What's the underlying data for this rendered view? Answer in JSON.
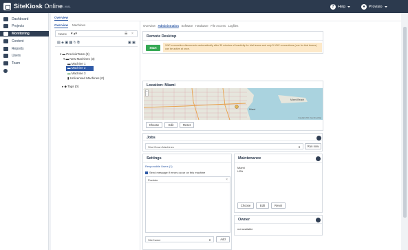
{
  "app": {
    "name_bold": "SiteKiosk",
    "name_light": "Online",
    "version": "v 1.1.9081"
  },
  "topbar": {
    "help_label": "Help",
    "user_label": "Provisio"
  },
  "sidebar": {
    "items": [
      {
        "label": "Dashboard",
        "icon": "dashboard-icon",
        "active": false
      },
      {
        "label": "Projects",
        "icon": "projects-icon",
        "active": false
      },
      {
        "label": "Monitoring",
        "icon": "monitoring-icon",
        "active": true
      },
      {
        "label": "Content",
        "icon": "content-icon",
        "active": false
      },
      {
        "label": "Reports",
        "icon": "reports-icon",
        "active": false
      },
      {
        "label": "Users",
        "icon": "users-icon",
        "active": false
      },
      {
        "label": "Team",
        "icon": "team-icon",
        "active": false
      },
      {
        "label": "",
        "icon": "info-icon",
        "active": false
      }
    ]
  },
  "header_tabs": [
    {
      "label": "Overview",
      "selected": true
    }
  ],
  "left_tabs": [
    {
      "label": "Overview",
      "selected": true
    },
    {
      "label": "Machines",
      "selected": false
    }
  ],
  "filter": {
    "sort_label": "Name"
  },
  "tree": [
    {
      "label": "ProvisioTeam (3)",
      "level": 0
    },
    {
      "label": "New Machines (3)",
      "level": 1
    },
    {
      "label": "Machine 1",
      "level": 2
    },
    {
      "label": "Machine 2",
      "level": 2,
      "selected": true
    },
    {
      "label": "Machine 3",
      "level": 2
    },
    {
      "label": "Unlicensed Machines (0)",
      "level": 1
    },
    {
      "label": "Tags (0)",
      "level": 0
    }
  ],
  "subtabs": [
    {
      "label": "Overview",
      "selected": false
    },
    {
      "label": "Administration",
      "selected": true
    },
    {
      "label": "Software",
      "selected": false
    },
    {
      "label": "Hardware",
      "selected": false
    },
    {
      "label": "File Access",
      "selected": false
    },
    {
      "label": "Logfiles",
      "selected": false
    }
  ],
  "remote_desktop": {
    "title": "Remote Desktop",
    "start_label": "Start",
    "notice": "VNC connection disconnects automatically after 30 minutes of inactivity for trial teams and only 5 VNC connections (one for trial teams) can be active at once."
  },
  "location": {
    "title": "Location: Miami",
    "choose_label": "Choose",
    "edit_label": "Edit",
    "reset_label": "Reset",
    "map_labels": [
      "Miami Beach",
      "Miami"
    ],
    "copyright": "Copyright 2021 OpenStreetMap"
  },
  "jobs": {
    "title": "Jobs",
    "select_value": "Shut Down Machines",
    "run_label": "Run now"
  },
  "settings": {
    "title": "Settings",
    "responsible_label": "Responsible Users (1)",
    "send_message_label": "Send message if errors occur on this machine",
    "users": [
      "Provisio"
    ],
    "select_value": "SiteCaster",
    "add_label": "Add"
  },
  "maintenance": {
    "title": "Maintenance",
    "lines": [
      "Miami",
      "USA"
    ],
    "choose_label": "Choose",
    "edit_label": "Edit",
    "reset_label": "Reset"
  },
  "owner": {
    "title": "Owner",
    "text": "not available"
  },
  "colors": {
    "topbar": "#2c3a4e",
    "accent": "#2d59a6",
    "start": "#34a853",
    "notice": "#fde9c9"
  }
}
